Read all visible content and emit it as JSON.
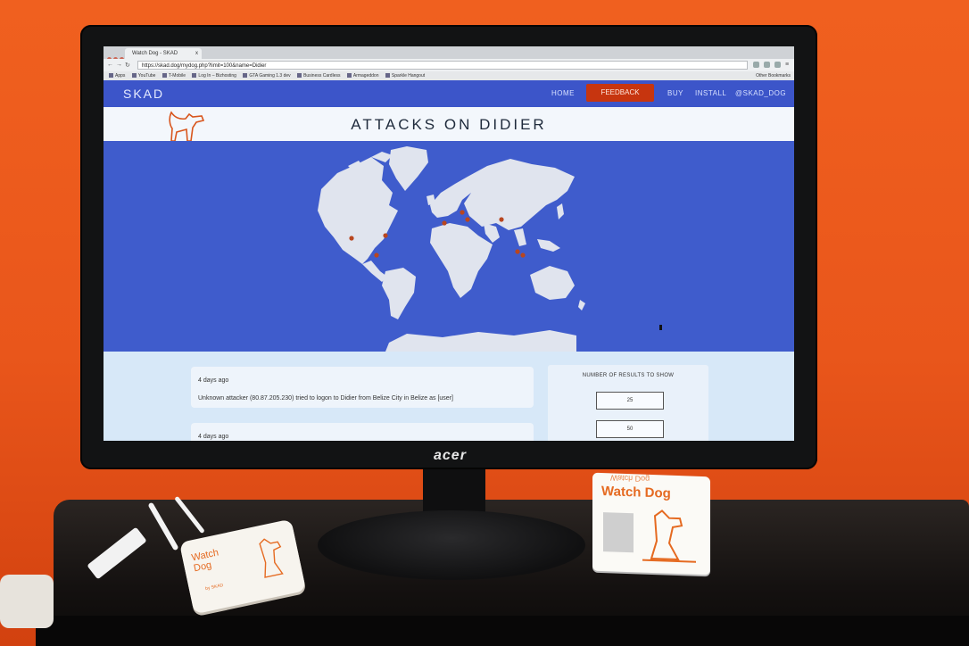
{
  "browser": {
    "tab_title": "Watch Dog - SKAD",
    "tab_close": "x",
    "url": "https://skad.dog/mydog.php?limit=100&name=Didier",
    "bookmarks": [
      "Apps",
      "YouTube",
      "T-Mobile",
      "Log In – Bizhosting",
      "GTA Gaming 1.3 dev",
      "Business Cardless",
      "Armageddon",
      "Sparkle Hangout"
    ],
    "other_bookmarks": "Other Bookmarks"
  },
  "site": {
    "logo": "SKAD",
    "nav": {
      "home": "HOME",
      "feedback": "FEEDBACK",
      "buy": "BUY",
      "install": "INSTALL",
      "handle": "@SKAD_DOG"
    },
    "title": "ATTACKS ON DIDIER",
    "colors": {
      "nav": "#3c55c9",
      "feedback": "#c7350f",
      "map_bg": "#3f5ccc",
      "land": "#dfe3ee",
      "dot": "#b8461f"
    }
  },
  "attacks": [
    {
      "time": "4 days ago",
      "message": "Unknown attacker (80.87.205.230) tried to logon to Didier from Belize City in Belize as [user]"
    },
    {
      "time": "4 days ago",
      "message": ""
    }
  ],
  "results_panel": {
    "title": "NUMBER OF RESULTS TO SHOW",
    "options": [
      "25",
      "50"
    ]
  },
  "hardware": {
    "monitor_brand": "acer",
    "box_label": "Watch Dog",
    "device_label_1": "Watch",
    "device_label_2": "Dog",
    "device_brand": "by SKAD"
  }
}
